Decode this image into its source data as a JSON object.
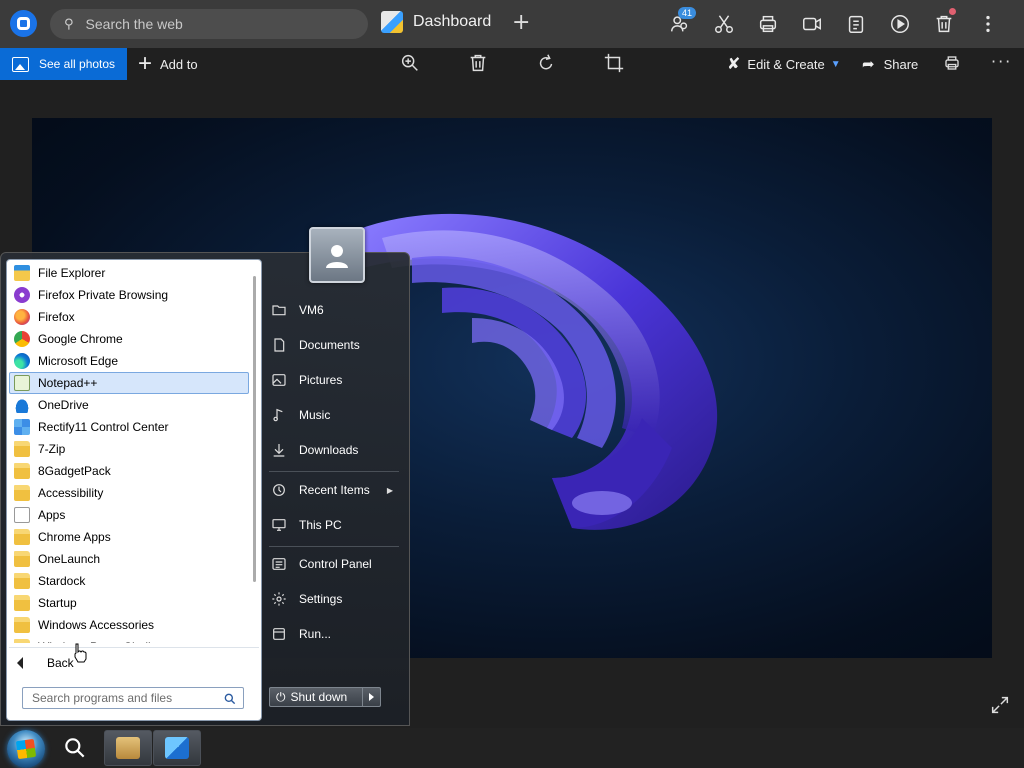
{
  "browser": {
    "search_placeholder": "Search the web",
    "tab_title": "Dashboard",
    "notification_count": "41",
    "toolbar_icons": [
      "people-icon",
      "scissors-icon",
      "print-icon",
      "video-icon",
      "clipboard-icon",
      "play-icon",
      "trash-icon",
      "more-icon"
    ]
  },
  "photos_toolbar": {
    "see_all_label": "See all photos",
    "add_to_label": "Add to",
    "edit_create_label": "Edit & Create",
    "share_label": "Share",
    "icons": [
      "zoom-in-icon",
      "delete-icon",
      "rotate-icon",
      "crop-icon",
      "print-icon",
      "more-icon"
    ]
  },
  "start_menu": {
    "programs": [
      {
        "label": "File Explorer",
        "icon": "fexp"
      },
      {
        "label": "Firefox Private Browsing",
        "icon": "ffprivate"
      },
      {
        "label": "Firefox",
        "icon": "firefox"
      },
      {
        "label": "Google Chrome",
        "icon": "chrome"
      },
      {
        "label": "Microsoft Edge",
        "icon": "edge"
      },
      {
        "label": "Notepad++",
        "icon": "notepad",
        "selected": true
      },
      {
        "label": "OneDrive",
        "icon": "onedrive"
      },
      {
        "label": "Rectify11 Control Center",
        "icon": "rectify"
      },
      {
        "label": "7-Zip",
        "icon": "folder"
      },
      {
        "label": "8GadgetPack",
        "icon": "folder"
      },
      {
        "label": "Accessibility",
        "icon": "folder"
      },
      {
        "label": "Apps",
        "icon": "apps"
      },
      {
        "label": "Chrome Apps",
        "icon": "folder"
      },
      {
        "label": "OneLaunch",
        "icon": "folder"
      },
      {
        "label": "Stardock",
        "icon": "folder"
      },
      {
        "label": "Startup",
        "icon": "folder"
      },
      {
        "label": "Windows Accessories",
        "icon": "folder"
      },
      {
        "label": "Windows PowerShell",
        "icon": "folder"
      }
    ],
    "back_label": "Back",
    "search_placeholder": "Search programs and files",
    "right_items": {
      "user": "VM6",
      "documents": "Documents",
      "pictures": "Pictures",
      "music": "Music",
      "downloads": "Downloads",
      "recent": "Recent Items",
      "this_pc": "This PC",
      "control_panel": "Control Panel",
      "settings": "Settings",
      "run": "Run..."
    },
    "shutdown_label": "Shut down"
  },
  "colors": {
    "accent": "#0a6bd6",
    "selection": "#d6e6fb",
    "wallpaper_bloom": "#4a35d8"
  }
}
